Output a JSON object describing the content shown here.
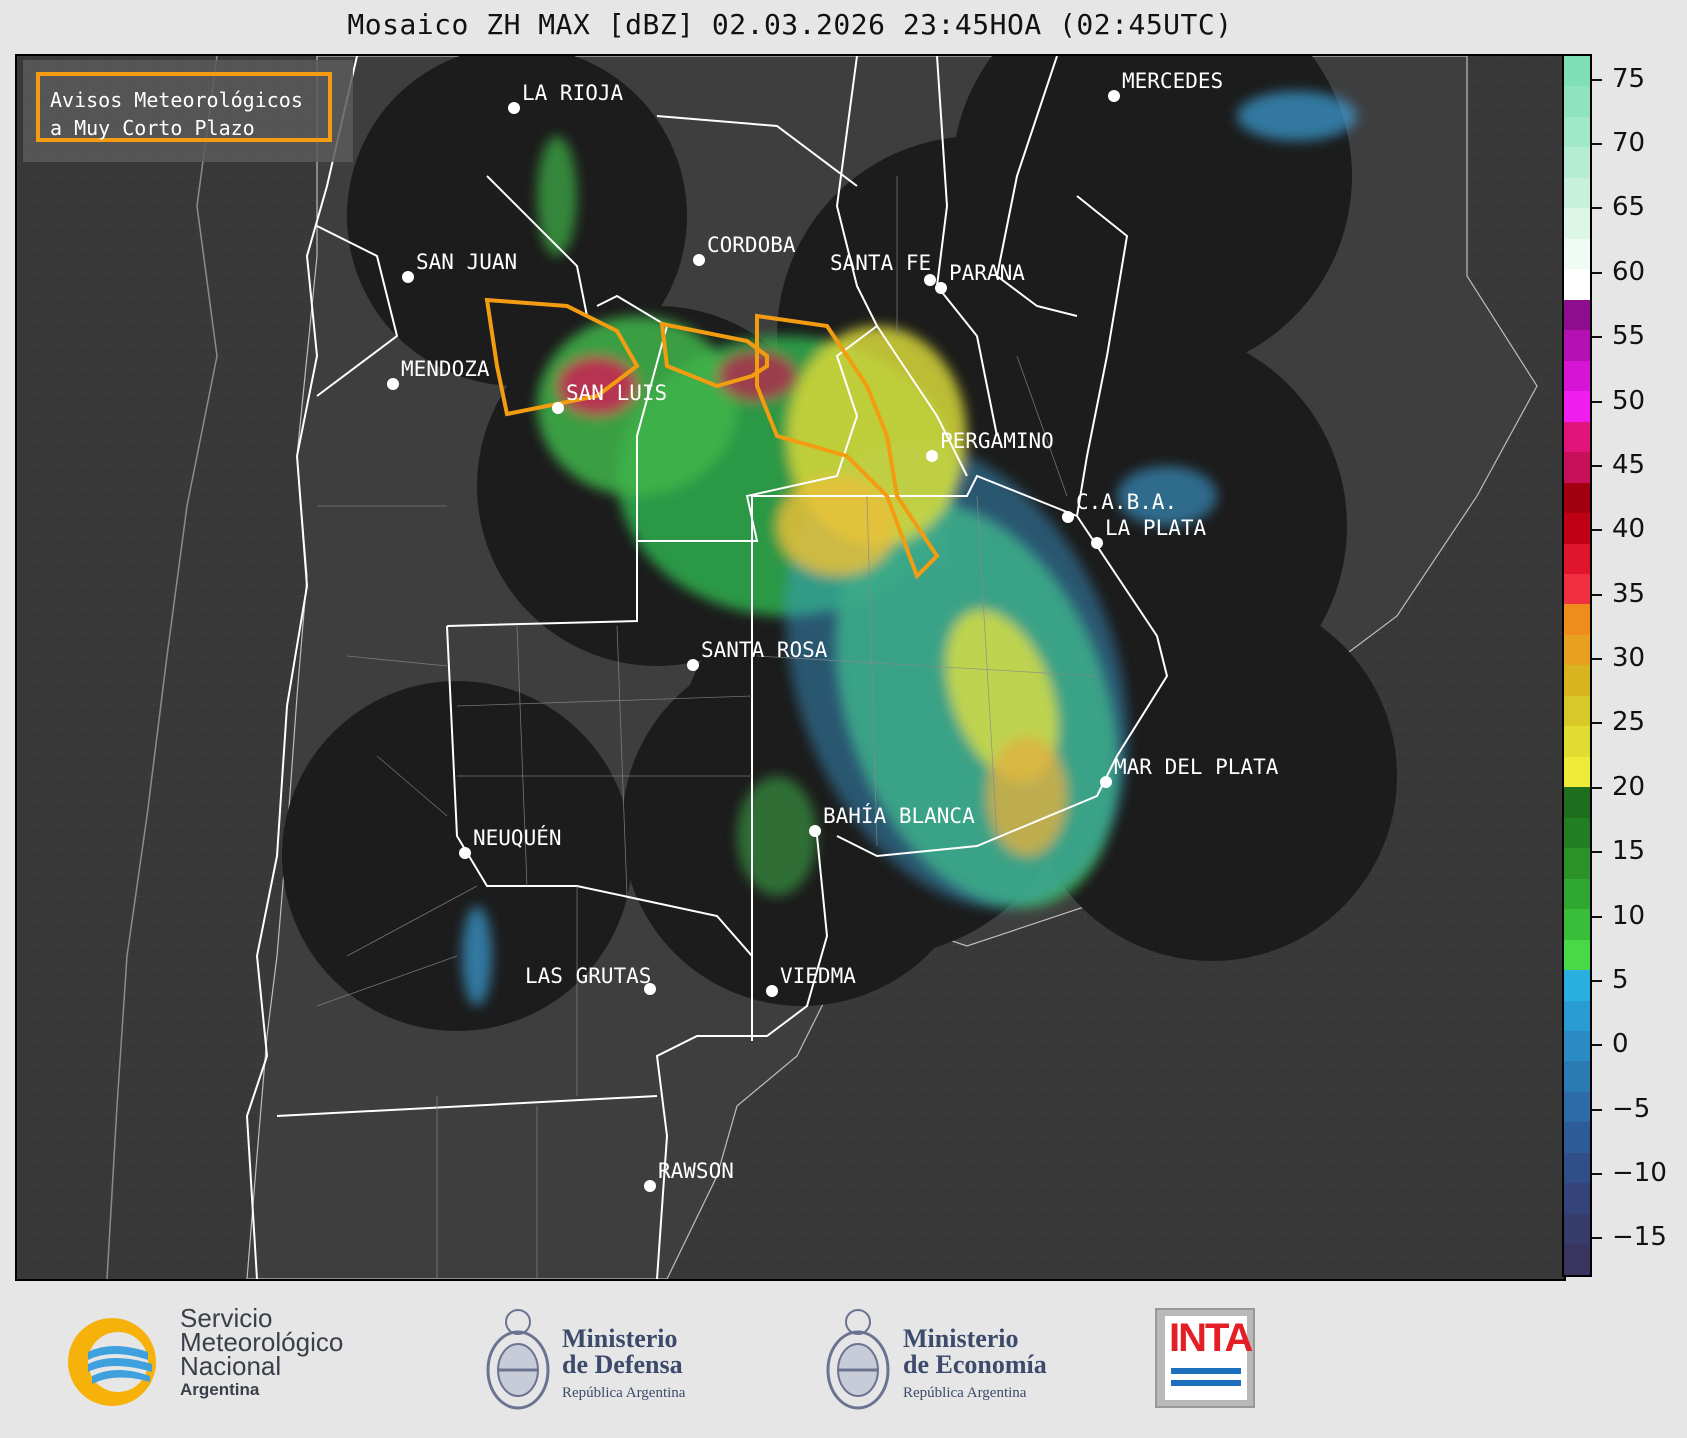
{
  "title": "Mosaico ZH MAX [dBZ] 02.03.2026 23:45HOA (02:45UTC)",
  "legend": {
    "line1": "Avisos Meteorológicos",
    "line2": "a Muy Corto Plazo",
    "border_color": "#f39c12"
  },
  "colorbar": {
    "ticks": [
      "75",
      "70",
      "65",
      "60",
      "55",
      "50",
      "45",
      "40",
      "35",
      "30",
      "25",
      "20",
      "15",
      "10",
      "5",
      "0",
      "−5",
      "−10",
      "−15"
    ],
    "range_dbz": [
      -18,
      77
    ]
  },
  "cities": [
    {
      "name": "LA RIOJA"
    },
    {
      "name": "MERCEDES"
    },
    {
      "name": "CORDOBA"
    },
    {
      "name": "SAN JUAN"
    },
    {
      "name": "SANTA FE"
    },
    {
      "name": "PARANA"
    },
    {
      "name": "MENDOZA"
    },
    {
      "name": "SAN LUIS"
    },
    {
      "name": "PERGAMINO"
    },
    {
      "name": "C.A.B.A."
    },
    {
      "name": "LA PLATA"
    },
    {
      "name": "SANTA ROSA"
    },
    {
      "name": "MAR DEL PLATA"
    },
    {
      "name": "BAHÍA BLANCA"
    },
    {
      "name": "NEUQUÉN"
    },
    {
      "name": "LAS GRUTAS"
    },
    {
      "name": "VIEDMA"
    },
    {
      "name": "RAWSON"
    }
  ],
  "footer": {
    "smn": {
      "line1": "Servicio",
      "line2": "Meteorológico",
      "line3": "Nacional",
      "line4": "Argentina"
    },
    "defensa": {
      "line1": "Ministerio",
      "line2": "de Defensa",
      "sub": "República Argentina"
    },
    "economia": {
      "line1": "Ministerio",
      "line2": "de Economía",
      "sub": "República Argentina"
    },
    "inta": {
      "word": "INTA"
    }
  }
}
